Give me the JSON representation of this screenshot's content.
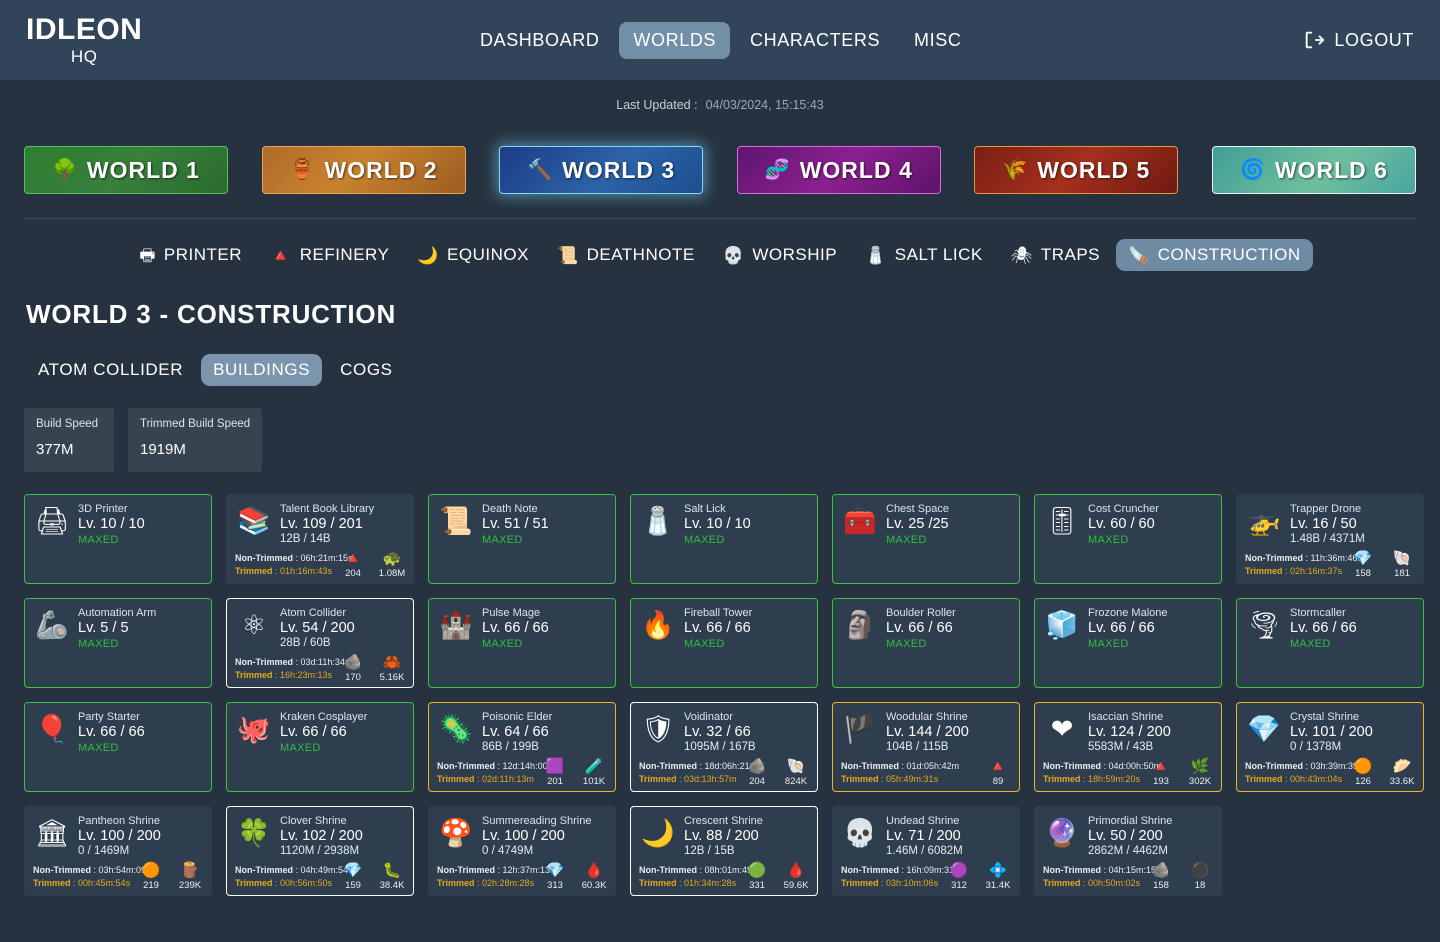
{
  "header": {
    "brand_main": "IDLEON",
    "brand_sub": "HQ",
    "nav": [
      {
        "label": "DASHBOARD",
        "active": false
      },
      {
        "label": "WORLDS",
        "active": true
      },
      {
        "label": "CHARACTERS",
        "active": false
      },
      {
        "label": "MISC",
        "active": false
      }
    ],
    "logout_label": "LOGOUT",
    "logout_icon": "logout-icon"
  },
  "updated": {
    "label": "Last Updated :",
    "value": "04/03/2024, 15:15:43"
  },
  "worlds": [
    {
      "label": "WORLD 1",
      "icon": "🌳",
      "class": "w1",
      "active": false
    },
    {
      "label": "WORLD 2",
      "icon": "🏺",
      "class": "w2",
      "active": false
    },
    {
      "label": "WORLD 3",
      "icon": "🔨",
      "class": "w3",
      "active": true
    },
    {
      "label": "WORLD 4",
      "icon": "🧬",
      "class": "w4",
      "active": false
    },
    {
      "label": "WORLD 5",
      "icon": "🌾",
      "class": "w5",
      "active": false
    },
    {
      "label": "WORLD 6",
      "icon": "🌀",
      "class": "w6",
      "active": false
    }
  ],
  "subnav": [
    {
      "label": "PRINTER",
      "icon": "🖶",
      "active": false
    },
    {
      "label": "REFINERY",
      "icon": "🔺",
      "active": false
    },
    {
      "label": "EQUINOX",
      "icon": "🌙",
      "active": false
    },
    {
      "label": "DEATHNOTE",
      "icon": "📜",
      "active": false
    },
    {
      "label": "WORSHIP",
      "icon": "💀",
      "active": false
    },
    {
      "label": "SALT LICK",
      "icon": "🧂",
      "active": false
    },
    {
      "label": "TRAPS",
      "icon": "🕷",
      "active": false
    },
    {
      "label": "CONSTRUCTION",
      "icon": "🪚",
      "active": true
    }
  ],
  "page_title": "WORLD 3 - CONSTRUCTION",
  "subtabs": [
    {
      "label": "ATOM COLLIDER",
      "active": false
    },
    {
      "label": "BUILDINGS",
      "active": true
    },
    {
      "label": "COGS",
      "active": false
    }
  ],
  "stats": [
    {
      "label": "Build Speed",
      "value": "377M"
    },
    {
      "label": "Trimmed Build Speed",
      "value": "1919M"
    }
  ],
  "time_labels": {
    "non_trimmed": "Non-Trimmed",
    "trimmed": "Trimmed"
  },
  "maxed_label": "MAXED",
  "colors": {
    "accent_active": "#738fa7",
    "maxed_green": "#2fbf3f",
    "trimmed_orange": "#e3a81e",
    "border_green": "#3ac13f",
    "border_white": "#ffffff",
    "border_orange": "#f0b429",
    "page_bg": "#26323f",
    "card_bg": "#2f3e4e"
  },
  "buildings": [
    {
      "name": "3D Printer",
      "icon": "🖨",
      "level": "Lv. 10 / 10",
      "maxed": "MAXED",
      "materials": "",
      "border": "b-green",
      "non_trimmed": "",
      "trimmed": "",
      "costs": []
    },
    {
      "name": "Talent Book Library",
      "icon": "📚",
      "level": "Lv. 109 / 201",
      "maxed": "",
      "materials": "12B / 14B",
      "border": "b-none",
      "non_trimmed": "06h:21m:15s",
      "trimmed": "01h:16m:43s",
      "costs": [
        {
          "icon": "🔺",
          "amount": "204"
        },
        {
          "icon": "🐢",
          "amount": "1.08M"
        }
      ]
    },
    {
      "name": "Death Note",
      "icon": "📜",
      "level": "Lv. 51 / 51",
      "maxed": "MAXED",
      "materials": "",
      "border": "b-green",
      "non_trimmed": "",
      "trimmed": "",
      "costs": []
    },
    {
      "name": "Salt Lick",
      "icon": "🧂",
      "level": "Lv. 10 / 10",
      "maxed": "MAXED",
      "materials": "",
      "border": "b-green",
      "non_trimmed": "",
      "trimmed": "",
      "costs": []
    },
    {
      "name": "Chest Space",
      "icon": "🧰",
      "level": "Lv. 25 /25",
      "maxed": "MAXED",
      "materials": "",
      "border": "b-green",
      "non_trimmed": "",
      "trimmed": "",
      "costs": []
    },
    {
      "name": "Cost Cruncher",
      "icon": "🎚",
      "level": "Lv. 60 / 60",
      "maxed": "MAXED",
      "materials": "",
      "border": "b-green",
      "non_trimmed": "",
      "trimmed": "",
      "costs": []
    },
    {
      "name": "Trapper Drone",
      "icon": "🚁",
      "level": "Lv. 16 / 50",
      "maxed": "",
      "materials": "1.48B / 4371M",
      "border": "b-none",
      "non_trimmed": "11h:36m:46s",
      "trimmed": "02h:16m:37s",
      "costs": [
        {
          "icon": "💎",
          "amount": "158"
        },
        {
          "icon": "🐚",
          "amount": "181"
        }
      ]
    },
    {
      "name": "Automation Arm",
      "icon": "🦾",
      "level": "Lv. 5 / 5",
      "maxed": "MAXED",
      "materials": "",
      "border": "b-green",
      "non_trimmed": "",
      "trimmed": "",
      "costs": []
    },
    {
      "name": "Atom Collider",
      "icon": "⚛",
      "level": "Lv. 54 / 200",
      "maxed": "",
      "materials": "28B / 60B",
      "border": "b-white",
      "non_trimmed": "03d:11h:34m",
      "trimmed": "16h:23m:13s",
      "costs": [
        {
          "icon": "🪨",
          "amount": "170"
        },
        {
          "icon": "🦀",
          "amount": "5.16K"
        }
      ]
    },
    {
      "name": "Pulse Mage",
      "icon": "🏰",
      "level": "Lv. 66 / 66",
      "maxed": "MAXED",
      "materials": "",
      "border": "b-green",
      "non_trimmed": "",
      "trimmed": "",
      "costs": []
    },
    {
      "name": "Fireball Tower",
      "icon": "🔥",
      "level": "Lv. 66 / 66",
      "maxed": "MAXED",
      "materials": "",
      "border": "b-green",
      "non_trimmed": "",
      "trimmed": "",
      "costs": []
    },
    {
      "name": "Boulder Roller",
      "icon": "🗿",
      "level": "Lv. 66 / 66",
      "maxed": "MAXED",
      "materials": "",
      "border": "b-green",
      "non_trimmed": "",
      "trimmed": "",
      "costs": []
    },
    {
      "name": "Frozone Malone",
      "icon": "🧊",
      "level": "Lv. 66 / 66",
      "maxed": "MAXED",
      "materials": "",
      "border": "b-green",
      "non_trimmed": "",
      "trimmed": "",
      "costs": []
    },
    {
      "name": "Stormcaller",
      "icon": "🌪",
      "level": "Lv. 66 / 66",
      "maxed": "MAXED",
      "materials": "",
      "border": "b-green",
      "non_trimmed": "",
      "trimmed": "",
      "costs": []
    },
    {
      "name": "Party Starter",
      "icon": "🎈",
      "level": "Lv. 66 / 66",
      "maxed": "MAXED",
      "materials": "",
      "border": "b-green",
      "non_trimmed": "",
      "trimmed": "",
      "costs": []
    },
    {
      "name": "Kraken Cosplayer",
      "icon": "🐙",
      "level": "Lv. 66 / 66",
      "maxed": "MAXED",
      "materials": "",
      "border": "b-green",
      "non_trimmed": "",
      "trimmed": "",
      "costs": []
    },
    {
      "name": "Poisonic Elder",
      "icon": "🦠",
      "level": "Lv. 64 / 66",
      "maxed": "",
      "materials": "86B / 199B",
      "border": "b-orange",
      "non_trimmed": "12d:14h:00m",
      "trimmed": "02d:11h:13m",
      "costs": [
        {
          "icon": "🟪",
          "amount": "201"
        },
        {
          "icon": "🧪",
          "amount": "101K"
        }
      ]
    },
    {
      "name": "Voidinator",
      "icon": "🛡",
      "level": "Lv. 32 / 66",
      "maxed": "",
      "materials": "1095M / 167B",
      "border": "b-white",
      "non_trimmed": "18d:06h:21m",
      "trimmed": "03d:13h:57m",
      "costs": [
        {
          "icon": "🪨",
          "amount": "204"
        },
        {
          "icon": "🐚",
          "amount": "824K"
        }
      ]
    },
    {
      "name": "Woodular Shrine",
      "icon": "🏴",
      "level": "Lv. 144 / 200",
      "maxed": "",
      "materials": "104B / 115B",
      "border": "b-orange",
      "non_trimmed": "01d:05h:42m",
      "trimmed": "05h:49m:31s",
      "costs": [
        {
          "icon": "🔺",
          "amount": "89"
        }
      ]
    },
    {
      "name": "Isaccian Shrine",
      "icon": "❤",
      "level": "Lv. 124 / 200",
      "maxed": "",
      "materials": "5583M / 43B",
      "border": "b-orange",
      "non_trimmed": "04d:00h:50m",
      "trimmed": "18h:59m:20s",
      "costs": [
        {
          "icon": "🔺",
          "amount": "193"
        },
        {
          "icon": "🌿",
          "amount": "302K"
        }
      ]
    },
    {
      "name": "Crystal Shrine",
      "icon": "💎",
      "level": "Lv. 101 / 200",
      "maxed": "",
      "materials": "0 / 1378M",
      "border": "b-orange",
      "non_trimmed": "03h:39m:39s",
      "trimmed": "00h:43m:04s",
      "costs": [
        {
          "icon": "🟠",
          "amount": "126"
        },
        {
          "icon": "🥟",
          "amount": "33.6K"
        }
      ]
    },
    {
      "name": "Pantheon Shrine",
      "icon": "🏛",
      "level": "Lv. 100 / 200",
      "maxed": "",
      "materials": "0 / 1469M",
      "border": "b-none",
      "non_trimmed": "03h:54m:09s",
      "trimmed": "00h:45m:54s",
      "costs": [
        {
          "icon": "🟠",
          "amount": "219"
        },
        {
          "icon": "🪵",
          "amount": "239K"
        }
      ]
    },
    {
      "name": "Clover Shrine",
      "icon": "🍀",
      "level": "Lv. 102 / 200",
      "maxed": "",
      "materials": "1120M / 2938M",
      "border": "b-white",
      "non_trimmed": "04h:49m:54s",
      "trimmed": "00h:56m:50s",
      "costs": [
        {
          "icon": "💎",
          "amount": "159"
        },
        {
          "icon": "🐛",
          "amount": "38.4K"
        }
      ]
    },
    {
      "name": "Summereading Shrine",
      "icon": "🍄",
      "level": "Lv. 100 / 200",
      "maxed": "",
      "materials": "0 / 4749M",
      "border": "b-none",
      "non_trimmed": "12h:37m:13s",
      "trimmed": "02h:28m:28s",
      "costs": [
        {
          "icon": "💎",
          "amount": "313"
        },
        {
          "icon": "🩸",
          "amount": "60.3K"
        }
      ]
    },
    {
      "name": "Crescent Shrine",
      "icon": "🌙",
      "level": "Lv. 88 / 200",
      "maxed": "",
      "materials": "12B / 15B",
      "border": "b-white",
      "non_trimmed": "08h:01m:49s",
      "trimmed": "01h:34m:28s",
      "costs": [
        {
          "icon": "🟢",
          "amount": "331"
        },
        {
          "icon": "🩸",
          "amount": "59.6K"
        }
      ]
    },
    {
      "name": "Undead Shrine",
      "icon": "💀",
      "level": "Lv. 71 / 200",
      "maxed": "",
      "materials": "1.46M / 6082M",
      "border": "b-none",
      "non_trimmed": "16h:09m:31s",
      "trimmed": "03h:10m:06s",
      "costs": [
        {
          "icon": "🟣",
          "amount": "312"
        },
        {
          "icon": "💠",
          "amount": "31.4K"
        }
      ]
    },
    {
      "name": "Primordial Shrine",
      "icon": "🔮",
      "level": "Lv. 50 / 200",
      "maxed": "",
      "materials": "2862M / 4462M",
      "border": "b-none",
      "non_trimmed": "04h:15m:150",
      "trimmed": "00h:50m:02s",
      "costs": [
        {
          "icon": "🪨",
          "amount": "158"
        },
        {
          "icon": "⚫",
          "amount": "18"
        }
      ]
    }
  ]
}
